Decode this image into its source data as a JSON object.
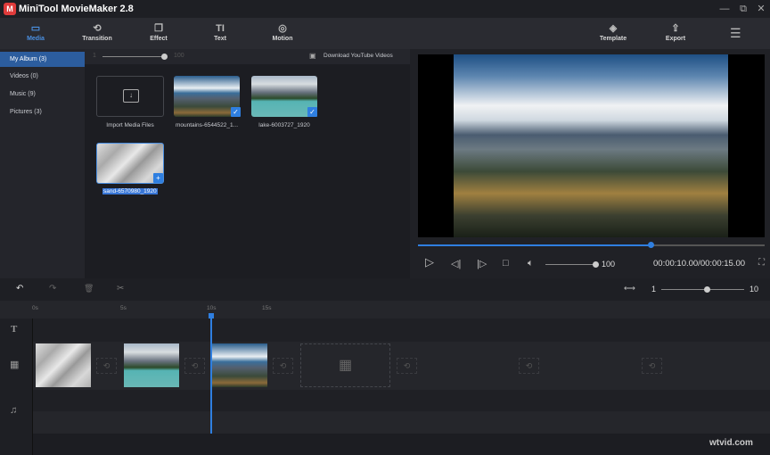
{
  "app": {
    "title": "MiniTool MovieMaker 2.8",
    "logo": "M"
  },
  "window": {
    "minimize": "—",
    "restore": "⧉",
    "close": "✕"
  },
  "toolbar": {
    "items": [
      {
        "label": "Media",
        "icon": "▭"
      },
      {
        "label": "Transition",
        "icon": "⟲"
      },
      {
        "label": "Effect",
        "icon": "❐"
      },
      {
        "label": "Text",
        "icon": "TI"
      },
      {
        "label": "Motion",
        "icon": "◎"
      }
    ],
    "template": "Template",
    "export": "Export",
    "template_icon": "◈",
    "export_icon": "⇪",
    "menu_icon": "☰"
  },
  "sidebar": {
    "items": [
      {
        "label": "My Album",
        "count": "(3)"
      },
      {
        "label": "Videos",
        "count": "(0)"
      },
      {
        "label": "Music",
        "count": "(9)"
      },
      {
        "label": "Pictures",
        "count": "(3)"
      }
    ]
  },
  "mediabar": {
    "zoom_min": "1",
    "zoom_max": "100",
    "download": "Download YouTube Videos"
  },
  "media": {
    "import": "Import Media Files",
    "items": [
      {
        "name": "mountains-6544522_1..."
      },
      {
        "name": "lake-6003727_1920"
      },
      {
        "name": "sand-6570980_1920"
      }
    ]
  },
  "player": {
    "progress": 0.67,
    "volume": "100",
    "time": "00:00:10.00/00:00:15.00"
  },
  "timeline": {
    "zoom_min": "1",
    "zoom_max": "10",
    "zoom_value": 0.55,
    "ticks": [
      "0s",
      "5s",
      "10s",
      "15s"
    ]
  }
}
